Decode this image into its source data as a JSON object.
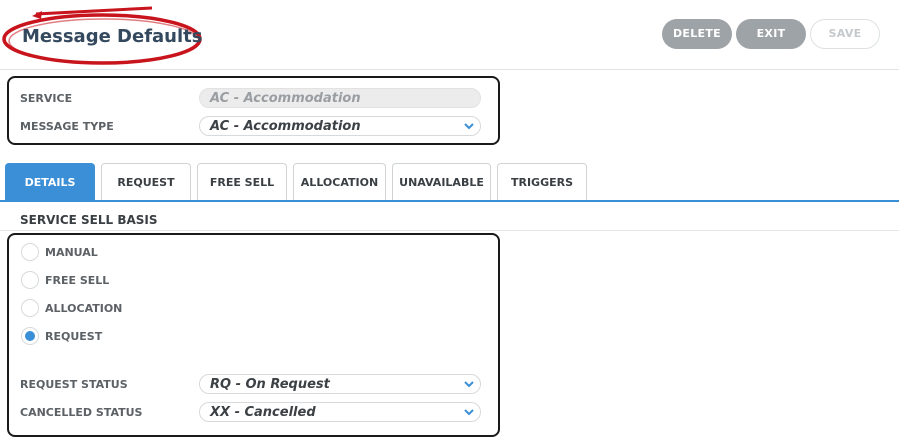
{
  "header": {
    "title": "Message Defaults",
    "buttons": {
      "delete": "DELETE",
      "exit": "EXIT",
      "save": "SAVE"
    }
  },
  "service_box": {
    "service_label": "SERVICE",
    "service_value": "AC - Accommodation",
    "message_type_label": "MESSAGE TYPE",
    "message_type_value": "AC - Accommodation"
  },
  "tabs": [
    {
      "label": "DETAILS",
      "active": true
    },
    {
      "label": "REQUEST",
      "active": false
    },
    {
      "label": "FREE SELL",
      "active": false
    },
    {
      "label": "ALLOCATION",
      "active": false
    },
    {
      "label": "UNAVAILABLE",
      "active": false
    },
    {
      "label": "TRIGGERS",
      "active": false
    }
  ],
  "details": {
    "section_title": "SERVICE SELL BASIS",
    "radios": [
      {
        "label": "MANUAL",
        "selected": false
      },
      {
        "label": "FREE SELL",
        "selected": false
      },
      {
        "label": "ALLOCATION",
        "selected": false
      },
      {
        "label": "REQUEST",
        "selected": true
      }
    ],
    "request_status_label": "REQUEST STATUS",
    "request_status_value": "RQ - On Request",
    "cancelled_status_label": "CANCELLED STATUS",
    "cancelled_status_value": "XX - Cancelled"
  },
  "colors": {
    "accent": "#3a8fd6",
    "title_color": "#34495e",
    "annotation_red": "#c8141c",
    "button_grey": "#9ea3a8"
  },
  "icons": {
    "dropdown": "chevron-down-icon"
  }
}
